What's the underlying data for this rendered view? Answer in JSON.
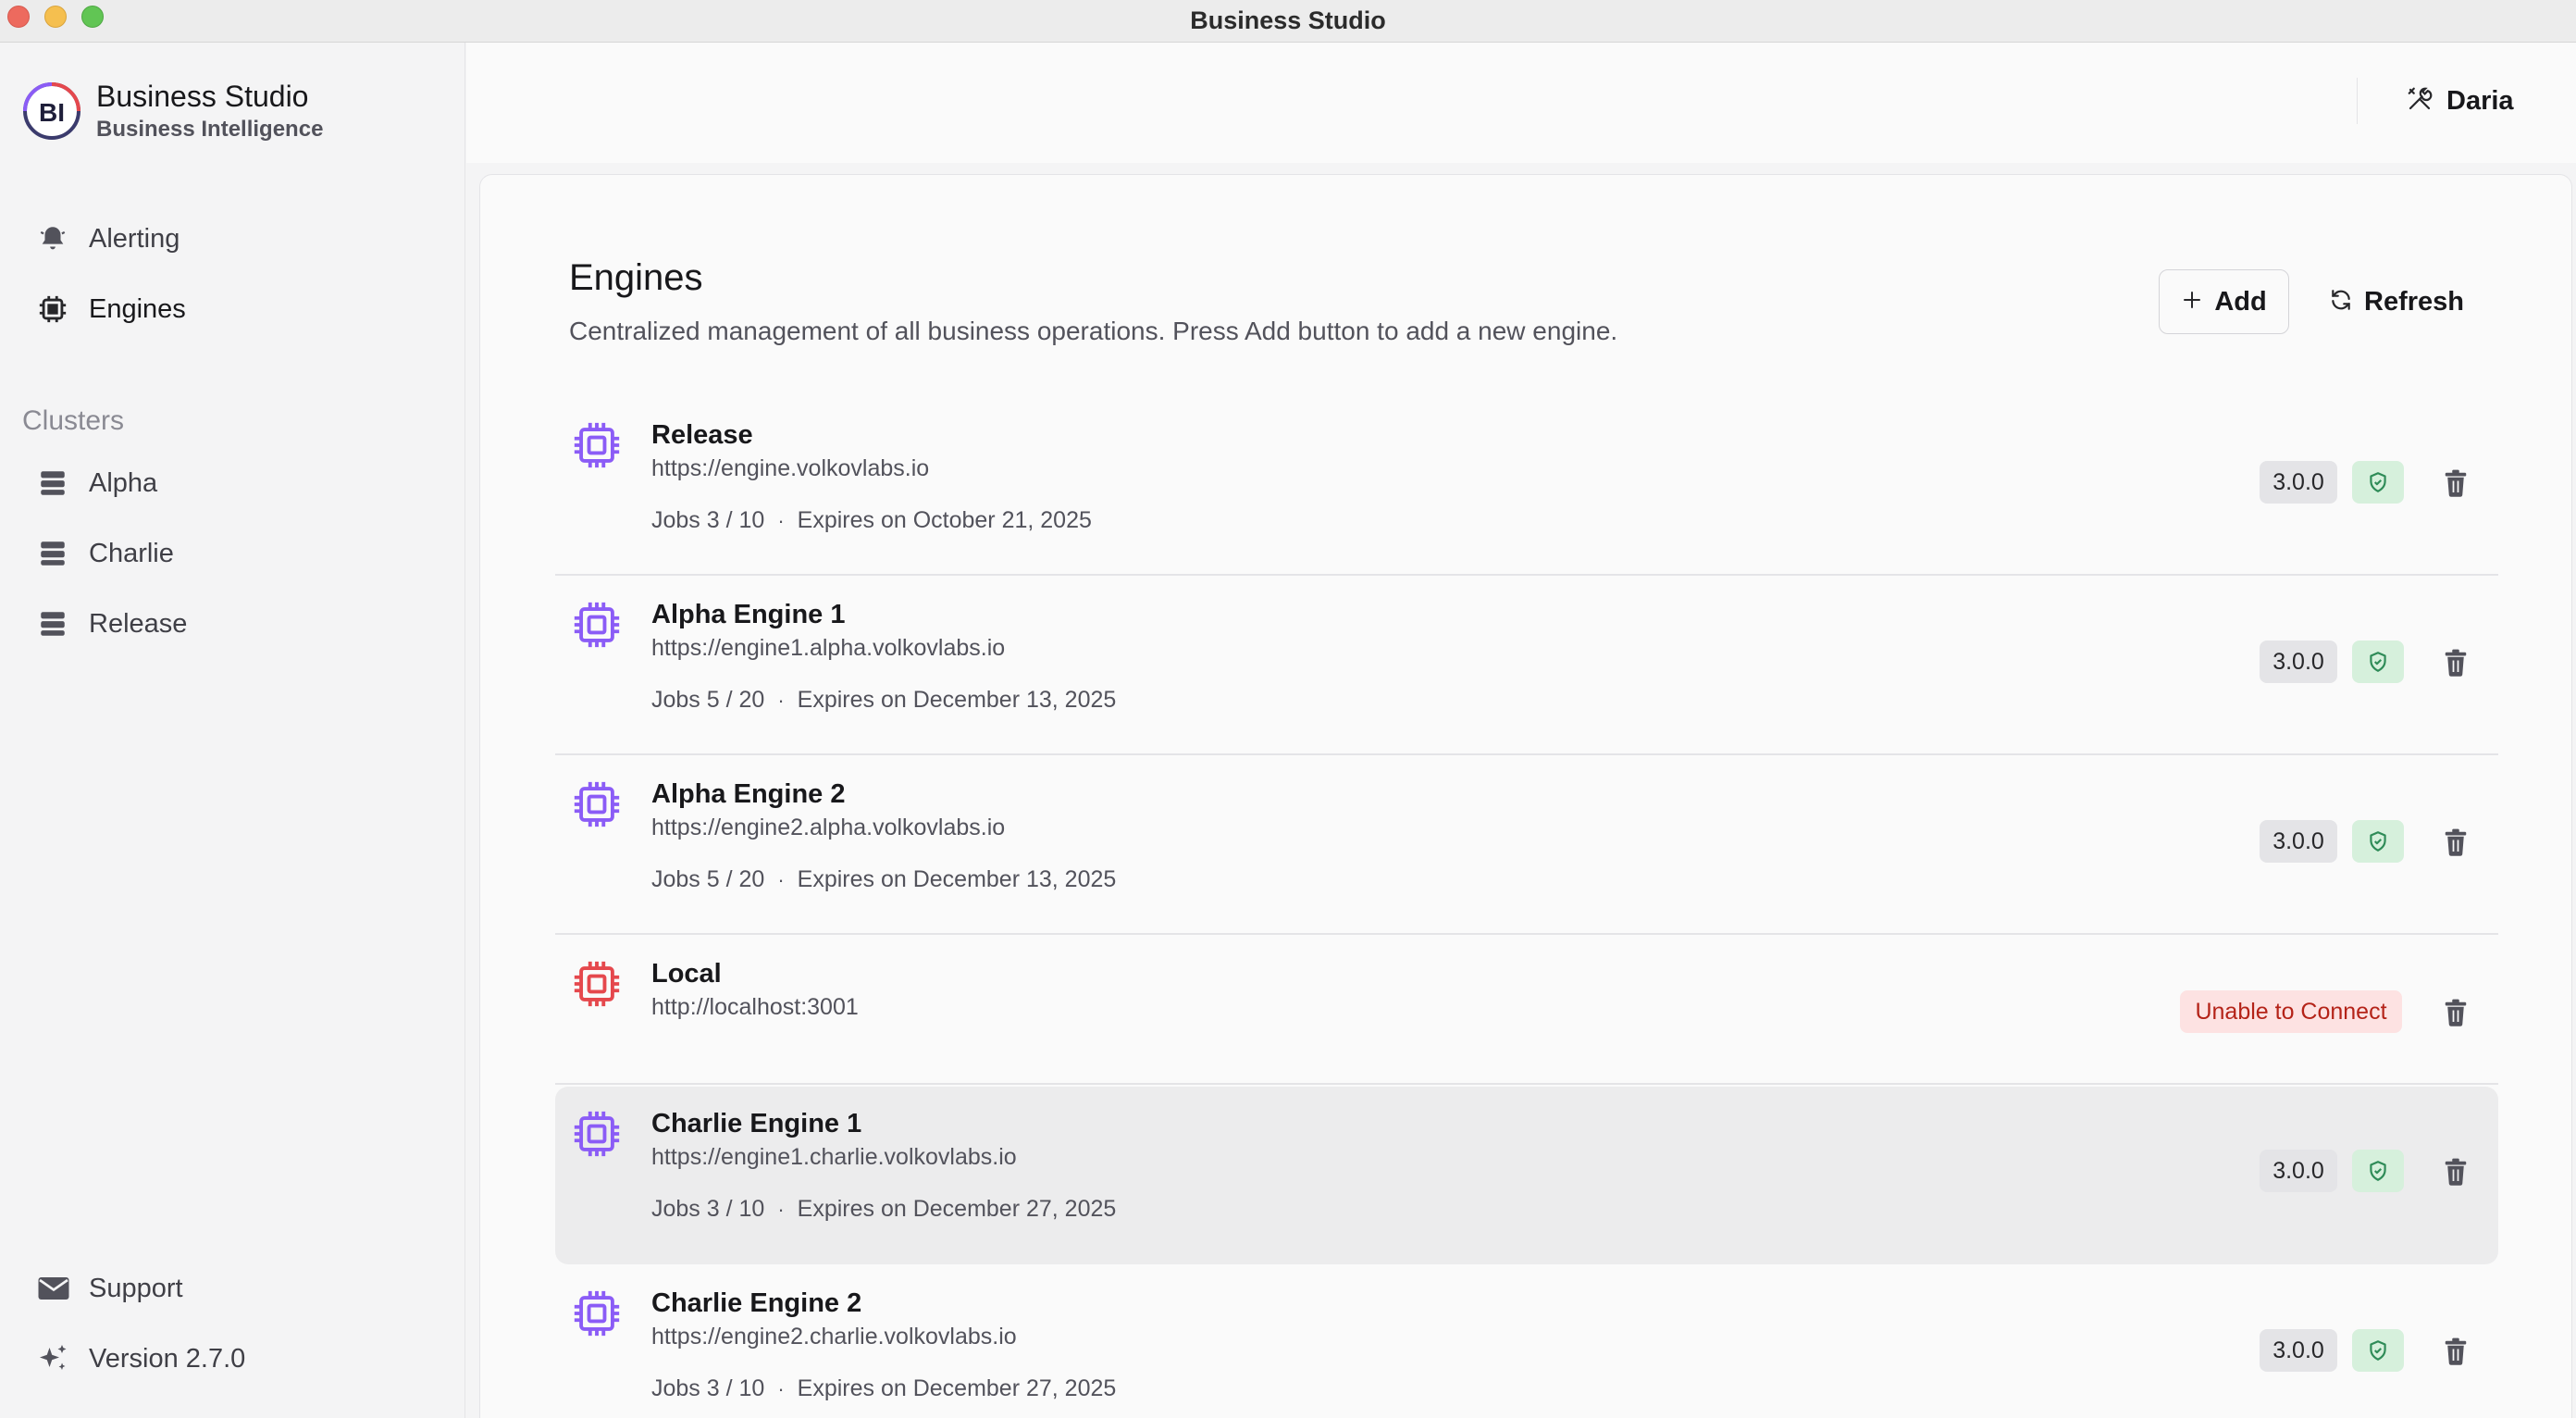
{
  "window": {
    "title": "Business Studio"
  },
  "brand": {
    "logo_text": "BI",
    "name": "Business Studio",
    "subtitle": "Business Intelligence"
  },
  "sidebar": {
    "nav": [
      {
        "label": "Alerting",
        "icon": "bell-icon"
      },
      {
        "label": "Engines",
        "icon": "chip-icon",
        "active": true
      }
    ],
    "clusters_title": "Clusters",
    "clusters": [
      {
        "label": "Alpha",
        "icon": "server-icon"
      },
      {
        "label": "Charlie",
        "icon": "server-icon"
      },
      {
        "label": "Release",
        "icon": "server-icon"
      }
    ],
    "footer": [
      {
        "label": "Support",
        "icon": "mail-icon"
      },
      {
        "label": "Version 2.7.0",
        "icon": "sparkles-icon"
      }
    ]
  },
  "header": {
    "user": "Daria",
    "user_icon": "tools-icon"
  },
  "page": {
    "title": "Engines",
    "description": "Centralized management of all business operations. Press Add button to add a new engine.",
    "add_label": "Add",
    "refresh_label": "Refresh"
  },
  "engines": [
    {
      "name": "Release",
      "url": "https://engine.volkovlabs.io",
      "jobs": "Jobs 3 / 10",
      "expires": "Expires on October 21, 2025",
      "version": "3.0.0",
      "status": "ok"
    },
    {
      "name": "Alpha Engine 1",
      "url": "https://engine1.alpha.volkovlabs.io",
      "jobs": "Jobs 5 / 20",
      "expires": "Expires on December 13, 2025",
      "version": "3.0.0",
      "status": "ok"
    },
    {
      "name": "Alpha Engine 2",
      "url": "https://engine2.alpha.volkovlabs.io",
      "jobs": "Jobs 5 / 20",
      "expires": "Expires on December 13, 2025",
      "version": "3.0.0",
      "status": "ok"
    },
    {
      "name": "Local",
      "url": "http://localhost:3001",
      "status": "error",
      "status_label": "Unable to Connect"
    },
    {
      "name": "Charlie Engine 1",
      "url": "https://engine1.charlie.volkovlabs.io",
      "jobs": "Jobs 3 / 10",
      "expires": "Expires on December 27, 2025",
      "version": "3.0.0",
      "status": "ok"
    },
    {
      "name": "Charlie Engine 2",
      "url": "https://engine2.charlie.volkovlabs.io",
      "jobs": "Jobs 3 / 10",
      "expires": "Expires on December 27, 2025",
      "version": "3.0.0",
      "status": "ok"
    }
  ],
  "colors": {
    "chip_ok": "#8b5cf6",
    "chip_error": "#e5484d",
    "shield_green": "#2e8b57",
    "error_text": "#b42318"
  }
}
